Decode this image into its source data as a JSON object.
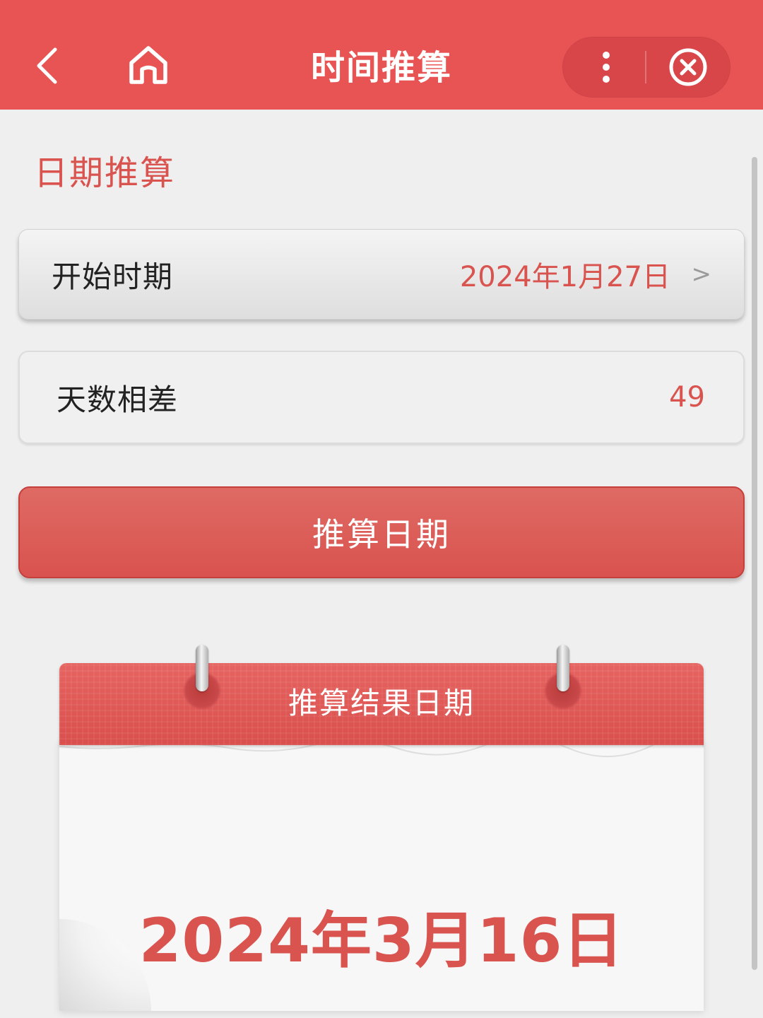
{
  "header": {
    "title": "时间推算",
    "icons": [
      "back-arrow-icon",
      "home-icon",
      "more-vertical-icon",
      "close-circle-icon"
    ]
  },
  "section": {
    "title": "日期推算"
  },
  "form": {
    "start_date": {
      "label": "开始时期",
      "value": "2024年1月27日",
      "chevron": ">"
    },
    "days_diff": {
      "label": "天数相差",
      "value": "49"
    }
  },
  "calc_button": {
    "label": "推算日期"
  },
  "result": {
    "header": "推算结果日期",
    "date": "2024年3月16日"
  },
  "colors": {
    "accent": "#e85453",
    "button": "#d9534f",
    "background": "#efefef"
  }
}
